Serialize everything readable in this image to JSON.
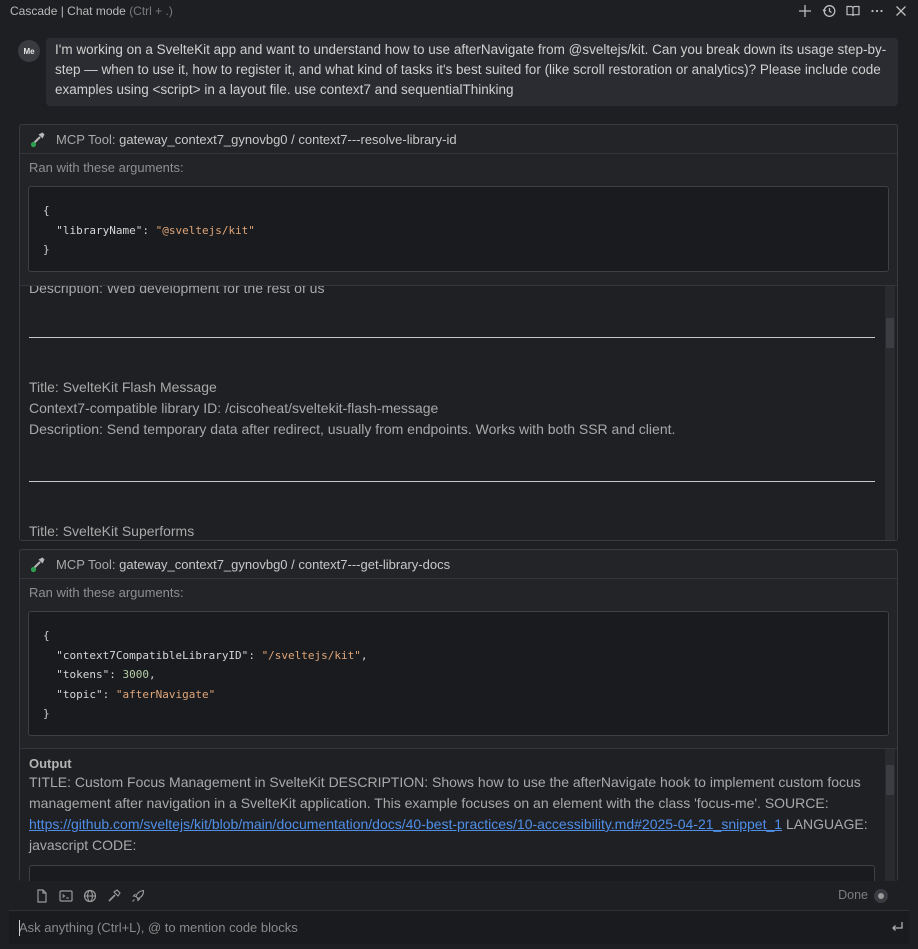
{
  "titlebar": {
    "title": "Cascade | Chat mode ",
    "shortcut": "(Ctrl + .)",
    "icons": [
      "plus-icon",
      "history-icon",
      "book-icon",
      "more-icon",
      "close-icon"
    ]
  },
  "user": {
    "avatar": "Me",
    "message": "I'm working on a SvelteKit app and want to understand how to use afterNavigate from @sveltejs/kit. Can you break down its usage step-by-step — when to use it, how to register it, and what kind of tasks it's best suited for (like scroll restoration or analytics)? Please include code examples using <script> in a layout file. use context7 and sequentialThinking"
  },
  "tool1": {
    "prefix": "MCP Tool: ",
    "name": "gateway_context7_gynovbg0 / context7---resolve-library-id",
    "ran_label": "Ran with these arguments:",
    "arg_key": "\"libraryName\"",
    "arg_value": "\"@sveltejs/kit\"",
    "output": {
      "partial_line": "Description: Web development for the rest of us",
      "entry_title": "Title: SvelteKit Flash Message",
      "entry_id": "Context7-compatible library ID: /ciscoheat/sveltekit-flash-message",
      "entry_desc": "Description: Send temporary data after redirect, usually from endpoints. Works with both SSR and client.",
      "next_title": "Title: SvelteKit Superforms"
    }
  },
  "tool2": {
    "prefix": "MCP Tool: ",
    "name": "gateway_context7_gynovbg0 / context7---get-library-docs",
    "ran_label": "Ran with these arguments:",
    "args": {
      "k1": "\"context7CompatibleLibraryID\"",
      "v1": "\"/sveltejs/kit\"",
      "k2": "\"tokens\"",
      "v2": "3000",
      "k3": "\"topic\"",
      "v3": "\"afterNavigate\""
    },
    "output": {
      "label": "Output",
      "text": "TITLE: Custom Focus Management in SvelteKit DESCRIPTION: Shows how to use the afterNavigate hook to implement custom focus management after navigation in a SvelteKit application. This example focuses on an element with the class 'focus-me'. SOURCE:",
      "link": "https://github.com/sveltejs/kit/blob/main/documentation/docs/40-best-practices/10-accessibility.md#2025-04-21_snippet_1",
      "language": "LANGUAGE: javascript CODE:"
    }
  },
  "bottom": {
    "icons": [
      "file-icon",
      "terminal-icon",
      "globe-icon",
      "hammer-icon",
      "rocket-icon"
    ],
    "done_label": "Done"
  },
  "input": {
    "placeholder": "Ask anything (Ctrl+L), @ to mention code blocks"
  }
}
